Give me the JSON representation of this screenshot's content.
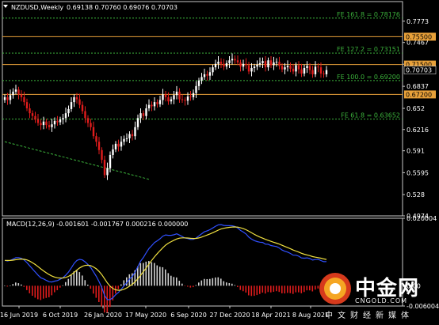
{
  "header": {
    "symbol": "NZDUSD,Weekly",
    "ohlc": "0.69138 0.70760 0.69076 0.70703"
  },
  "colors": {
    "background": "#000000",
    "frame": "#c8c8c8",
    "grid": "#3a3a3a",
    "bull": "#ffffff",
    "bear": "#e01c1c",
    "level": "#e8a13a",
    "fib": "#3cb43c",
    "macd_bar_pos": "#d0d0d0",
    "macd_bar_neg": "#e01c1c",
    "macd_signal": "#f0e040",
    "macd_line": "#3050ff"
  },
  "chart_data": [
    {
      "type": "candlestick",
      "title": "NZDUSD,Weekly",
      "y_ticks": [
        0.7773,
        0.7467,
        0.7155,
        0.6837,
        0.652,
        0.6216,
        0.591,
        0.5595,
        0.528,
        0.4974
      ],
      "x_tick_labels": [
        "16 Jun 2019",
        "6 Oct 2019",
        "26 Jan 2020",
        "17 May 2020",
        "6 Sep 2020",
        "27 Dec 2020",
        "18 Apr 2021",
        "8 Aug 2021"
      ],
      "ylim": [
        0.4974,
        0.8055
      ],
      "horizontal_levels": [
        {
          "label": "0.75500",
          "value": 0.755,
          "style": "solid"
        },
        {
          "label": "0.71500",
          "value": 0.715,
          "style": "solid"
        },
        {
          "label": "0.67200",
          "value": 0.672,
          "style": "solid"
        },
        {
          "label": "0.70703",
          "value": 0.70703,
          "style": "price"
        }
      ],
      "fib_levels": [
        {
          "label": "FE 161.8 = 0.78176",
          "value": 0.78176
        },
        {
          "label": "FE 127.2 = 0.73151",
          "value": 0.73151
        },
        {
          "label": "FE 100.0 = 0.69200",
          "value": 0.692
        },
        {
          "label": "FE 61.8 = 0.63652",
          "value": 0.63652
        }
      ],
      "trendline": {
        "from": {
          "x": 0,
          "y": 0.604
        },
        "to": {
          "x": 52,
          "y": 0.55
        }
      },
      "closes": [
        0.668,
        0.664,
        0.671,
        0.676,
        0.679,
        0.672,
        0.668,
        0.661,
        0.652,
        0.645,
        0.641,
        0.636,
        0.631,
        0.628,
        0.633,
        0.628,
        0.625,
        0.629,
        0.634,
        0.632,
        0.636,
        0.638,
        0.645,
        0.651,
        0.661,
        0.668,
        0.665,
        0.657,
        0.648,
        0.638,
        0.631,
        0.625,
        0.612,
        0.604,
        0.592,
        0.578,
        0.556,
        0.566,
        0.585,
        0.593,
        0.601,
        0.597,
        0.604,
        0.608,
        0.609,
        0.615,
        0.612,
        0.625,
        0.638,
        0.645,
        0.641,
        0.652,
        0.657,
        0.655,
        0.661,
        0.658,
        0.664,
        0.672,
        0.668,
        0.662,
        0.665,
        0.671,
        0.676,
        0.665,
        0.664,
        0.663,
        0.669,
        0.668,
        0.674,
        0.684,
        0.692,
        0.697,
        0.701,
        0.699,
        0.704,
        0.711,
        0.716,
        0.719,
        0.716,
        0.712,
        0.717,
        0.721,
        0.723,
        0.721,
        0.718,
        0.712,
        0.716,
        0.714,
        0.705,
        0.71,
        0.712,
        0.715,
        0.717,
        0.72,
        0.711,
        0.721,
        0.714,
        0.718,
        0.719,
        0.713,
        0.708,
        0.711,
        0.713,
        0.709,
        0.705,
        0.714,
        0.708,
        0.702,
        0.71,
        0.713,
        0.707,
        0.701,
        0.712,
        0.711,
        0.702,
        0.701,
        0.707
      ]
    },
    {
      "type": "macd",
      "title": "MACD(12,26,9) -0.001601 -0.001767 0.000216 0.000000",
      "y_ticks": [
        0.020004,
        0.0,
        -0.006004
      ],
      "y_tick_labels": [
        "0.020004",
        "0.00",
        "-0.006004"
      ],
      "ylim": [
        -0.006004,
        0.020004
      ]
    }
  ],
  "watermark": {
    "brand": "中金网",
    "url": "CNGOLD.COM",
    "sub": "中文财经新媒体"
  }
}
